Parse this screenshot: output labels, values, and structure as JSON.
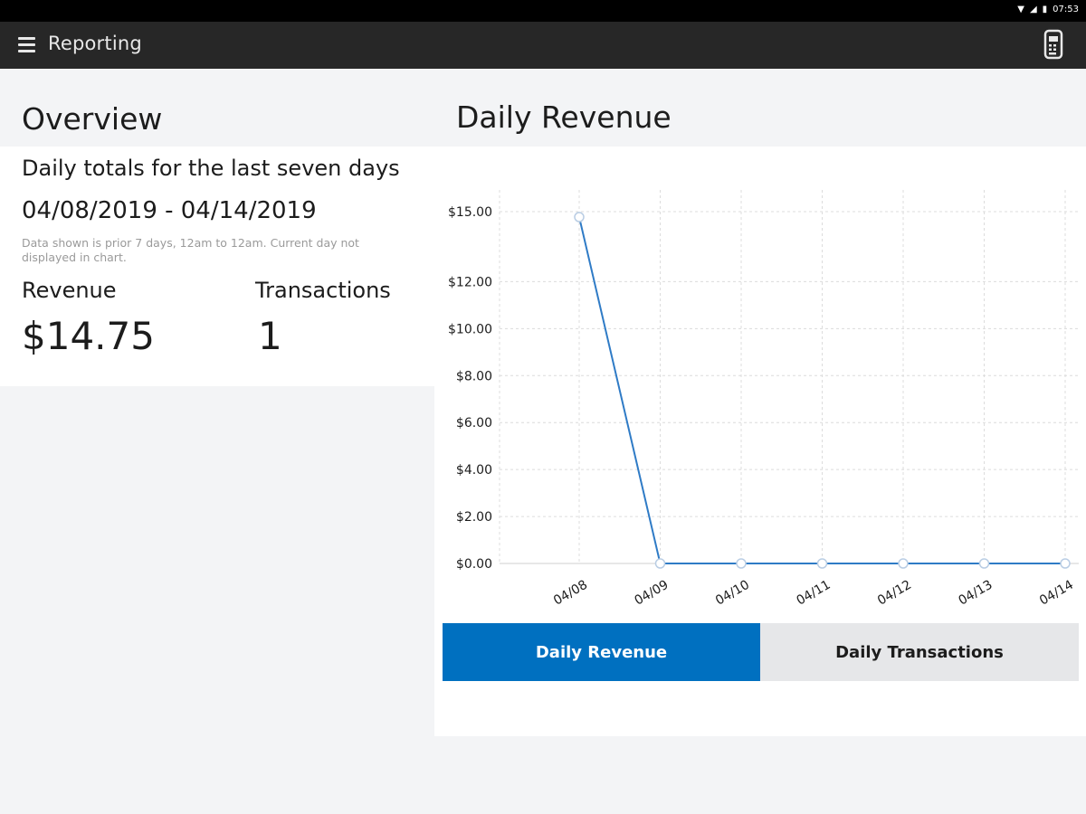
{
  "status_bar": {
    "time": "07:53",
    "icons": [
      "wifi-icon",
      "signal-icon",
      "battery-icon"
    ]
  },
  "app_bar": {
    "title": "Reporting",
    "menu_icon": "hamburger-menu-icon",
    "device_icon": "card-reader-icon"
  },
  "overview": {
    "title": "Overview",
    "subtitle": "Daily totals for the last seven days",
    "date_range": "04/08/2019 - 04/14/2019",
    "note": "Data shown is prior 7 days, 12am to 12am. Current day not displayed in chart.",
    "revenue_label": "Revenue",
    "revenue_value": "$14.75",
    "transactions_label": "Transactions",
    "transactions_value": "1"
  },
  "revenue_panel": {
    "title": "Daily Revenue",
    "tabs": [
      {
        "label": "Daily Revenue",
        "active": true
      },
      {
        "label": "Daily Transactions",
        "active": false
      }
    ]
  },
  "colors": {
    "accent": "#0070c0",
    "app_bar": "#272727",
    "background": "#f3f4f6"
  },
  "chart_data": {
    "type": "line",
    "categories": [
      "04/08",
      "04/09",
      "04/10",
      "04/11",
      "04/12",
      "04/13",
      "04/14"
    ],
    "series": [
      {
        "values": [
          14.75,
          0,
          0,
          0,
          0,
          0,
          0
        ]
      }
    ],
    "ylim": [
      0,
      15
    ],
    "y_ticks": [
      "$0.00",
      "$2.00",
      "$4.00",
      "$6.00",
      "$8.00",
      "$10.00",
      "$12.00",
      "$15.00"
    ],
    "y_tick_values": [
      0,
      2,
      4,
      6,
      8,
      10,
      12,
      14
    ],
    "grid": true,
    "line_color": "#2f7bc6"
  }
}
